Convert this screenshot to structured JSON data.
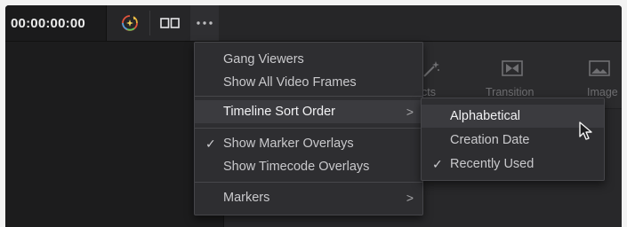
{
  "toolbar": {
    "timecode": "00:00:00:00",
    "color_icon": "color-wheel-sparkle-icon",
    "dual_viewer_icon": "dual-viewer-icon",
    "more_icon": "more-options-icon"
  },
  "effects_library": {
    "items": [
      {
        "label": "Effects",
        "icon": "magic-wand-icon"
      },
      {
        "label": "Transition",
        "icon": "transition-icon"
      },
      {
        "label": "Image",
        "icon": "image-icon"
      }
    ]
  },
  "options_menu": {
    "items": [
      {
        "label": "Gang Viewers",
        "checked": false,
        "submenu": false
      },
      {
        "label": "Show All Video Frames",
        "checked": false,
        "submenu": false
      },
      {
        "label": "Timeline Sort Order",
        "checked": false,
        "submenu": true
      },
      {
        "label": "Show Marker Overlays",
        "checked": true,
        "submenu": false
      },
      {
        "label": "Show Timecode Overlays",
        "checked": false,
        "submenu": false
      },
      {
        "label": "Markers",
        "checked": false,
        "submenu": true
      }
    ],
    "check_glyph": "✓",
    "arrow_glyph": ">"
  },
  "sort_submenu": {
    "items": [
      {
        "label": "Alphabetical",
        "checked": false
      },
      {
        "label": "Creation Date",
        "checked": false
      },
      {
        "label": "Recently Used",
        "checked": true
      }
    ]
  },
  "cursor": "mouse-pointer-icon",
  "colors": {
    "menu_bg": "#2e2e31",
    "highlight_bg": "#3b3b3f",
    "menu_text": "#c9c9cc",
    "highlight_text": "#f2f2f4"
  }
}
